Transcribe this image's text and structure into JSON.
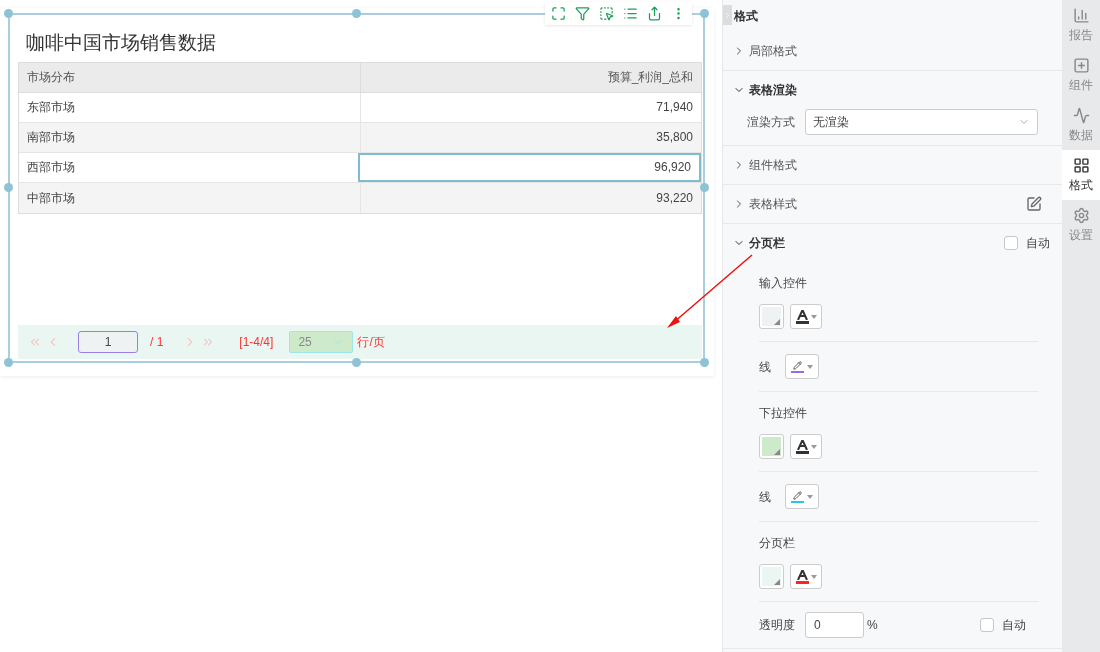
{
  "widget": {
    "title": "咖啡中国市场销售数据",
    "table": {
      "columns": [
        {
          "label": "市场分布"
        },
        {
          "label": "预算_利润_总和"
        }
      ],
      "rows": [
        {
          "cells": [
            {
              "text": "东部市场",
              "selected": false
            },
            {
              "text": "71,940",
              "selected": false
            }
          ]
        },
        {
          "cells": [
            {
              "text": "南部市场",
              "selected": false
            },
            {
              "text": "35,800",
              "selected": false
            }
          ]
        },
        {
          "cells": [
            {
              "text": "西部市场",
              "selected": false
            },
            {
              "text": "96,920",
              "selected": true
            }
          ]
        },
        {
          "cells": [
            {
              "text": "中部市场",
              "selected": false
            },
            {
              "text": "93,220",
              "selected": false
            }
          ]
        }
      ]
    },
    "pager": {
      "page": "1",
      "total": "/ 1",
      "range": "[1-4/4]",
      "page_size": "25",
      "unit": "行/页"
    }
  },
  "panel": {
    "title": "格式",
    "sections": [
      {
        "kind": "plain",
        "title": "局部格式",
        "expanded": false
      },
      {
        "kind": "render",
        "title": "表格渲染",
        "expanded": true,
        "field_label": "渲染方式",
        "field_value": "无渲染"
      },
      {
        "kind": "plain",
        "title": "组件格式",
        "expanded": false
      },
      {
        "kind": "edit",
        "title": "表格样式",
        "expanded": false
      },
      {
        "kind": "pager",
        "title": "分页栏",
        "expanded": true,
        "auto_label": "自动",
        "auto_checked": false,
        "groups": [
          {
            "kind": "fill_font",
            "label": "输入控件",
            "fill": {
              "color": "#eef2f3"
            },
            "font": {
              "color": "#333333"
            }
          },
          {
            "kind": "line",
            "label": "线",
            "color": "#9b6be0"
          },
          {
            "kind": "fill_font",
            "label": "下拉控件",
            "fill": {
              "color": "#cdebcb"
            },
            "font": {
              "color": "#333333"
            }
          },
          {
            "kind": "line",
            "label": "线",
            "color": "#2ec4e6"
          },
          {
            "kind": "fill_font",
            "label": "分页栏",
            "fill": {
              "color": "#eaf6f2"
            },
            "font": {
              "color": "#ff2222"
            }
          },
          {
            "kind": "opacity",
            "label": "透明度",
            "value": "0",
            "unit": "%",
            "auto_label": "自动",
            "auto_checked": false
          }
        ]
      }
    ]
  },
  "sidebar": {
    "tabs": [
      {
        "label": "报告",
        "selected": false
      },
      {
        "label": "组件",
        "selected": false
      },
      {
        "label": "数据",
        "selected": false
      },
      {
        "label": "格式",
        "selected": true
      },
      {
        "label": "设置",
        "selected": false
      }
    ]
  }
}
